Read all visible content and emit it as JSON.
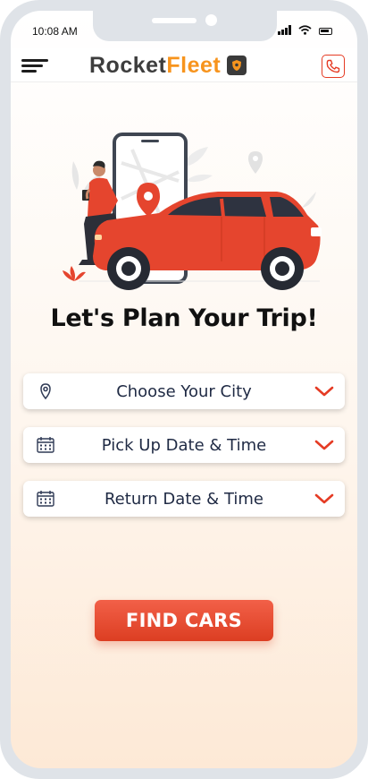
{
  "status_bar": {
    "time": "10:08 AM"
  },
  "header": {
    "brand_part1": "Rocket",
    "brand_part2": "Fleet",
    "brand_color": "#f7941d",
    "menu_icon": "hamburger-icon",
    "call_icon": "phone-icon"
  },
  "main": {
    "title": "Let's Plan Your Trip!",
    "fields": [
      {
        "label": "Choose Your City",
        "icon": "location-pin-icon"
      },
      {
        "label": "Pick Up Date & Time",
        "icon": "calendar-icon"
      },
      {
        "label": "Return Date & Time",
        "icon": "calendar-icon"
      }
    ],
    "find_button": "FIND CARS"
  },
  "colors": {
    "accent": "#e53b24",
    "button": "#e8472c",
    "text_dark": "#1f2a44"
  }
}
